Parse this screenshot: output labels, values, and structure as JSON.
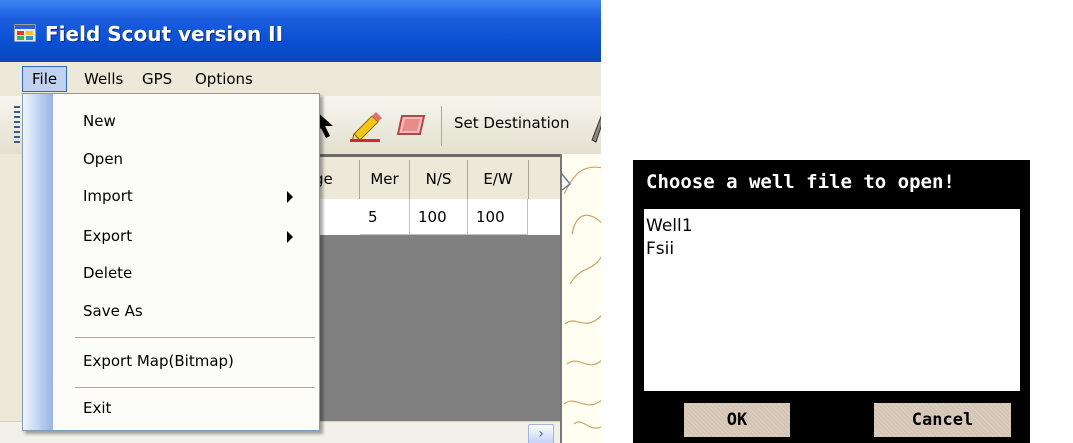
{
  "app": {
    "title": "Field Scout version II",
    "menu": [
      "File",
      "Wells",
      "GPS",
      "Options"
    ],
    "toolbar": {
      "set_destination": "Set Destination"
    },
    "grid": {
      "headers": [
        "ge",
        "Mer",
        "N/S",
        "E/W"
      ],
      "row": [
        "5",
        "100",
        "100"
      ]
    },
    "file_menu": {
      "items": [
        "New",
        "Open",
        "Import",
        "Export",
        "Delete",
        "Save As",
        "Export Map(Bitmap)",
        "Exit"
      ]
    }
  },
  "dialog": {
    "title": "Choose a well file to open!",
    "files": [
      "Well1",
      "Fsii"
    ],
    "ok_label": "OK",
    "cancel_label": "Cancel"
  },
  "colors": {
    "titlebar": "#0a4fd3",
    "menu_highlight": "#c1d2ee",
    "dialog_bg": "#000000",
    "dialog_button": "#d4c4b3"
  }
}
